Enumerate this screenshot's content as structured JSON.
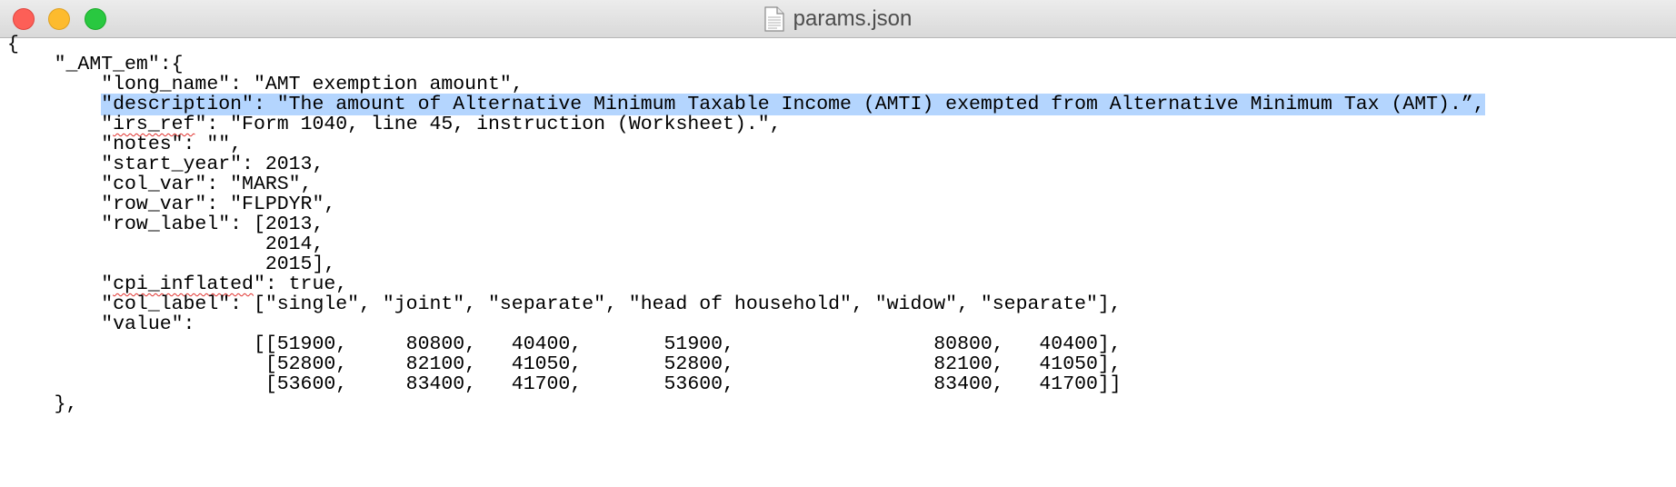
{
  "window": {
    "title": "params.json"
  },
  "editor": {
    "lines": [
      {
        "text": "{"
      },
      {
        "text": "    \"_AMT_em\":{"
      },
      {
        "text": "        \"long_name\": \"AMT exemption amount\","
      },
      {
        "text": "        \"description\": \"The amount of Alternative Minimum Taxable Income (AMTI) exempted from Alternative Minimum Tax (AMT).”,",
        "selected": true
      },
      {
        "pre": "        \"",
        "word": "irs_ref",
        "post": "\": \"Form 1040, line 45, instruction (Worksheet).\","
      },
      {
        "text": "        \"notes\": \"\","
      },
      {
        "text": "        \"start_year\": 2013,"
      },
      {
        "text": "        \"col_var\": \"MARS\","
      },
      {
        "text": "        \"row_var\": \"FLPDYR\","
      },
      {
        "text": "        \"row_label\": [2013,"
      },
      {
        "text": "                      2014,"
      },
      {
        "text": "                      2015],"
      },
      {
        "pre": "        \"",
        "word": "cpi_inflated",
        "post": "\": true,"
      },
      {
        "text": "        \"col_label\": [\"single\", \"joint\", \"separate\", \"head of household\", \"widow\", \"separate\"],"
      },
      {
        "text": "        \"value\":"
      },
      {
        "text": "                     [[51900,     80800,   40400,       51900,                 80800,   40400],"
      },
      {
        "text": "                      [52800,     82100,   41050,       52800,                 82100,   41050],"
      },
      {
        "text": "                      [53600,     83400,   41700,       53600,                 83400,   41700]]"
      },
      {
        "text": "    },"
      }
    ]
  }
}
